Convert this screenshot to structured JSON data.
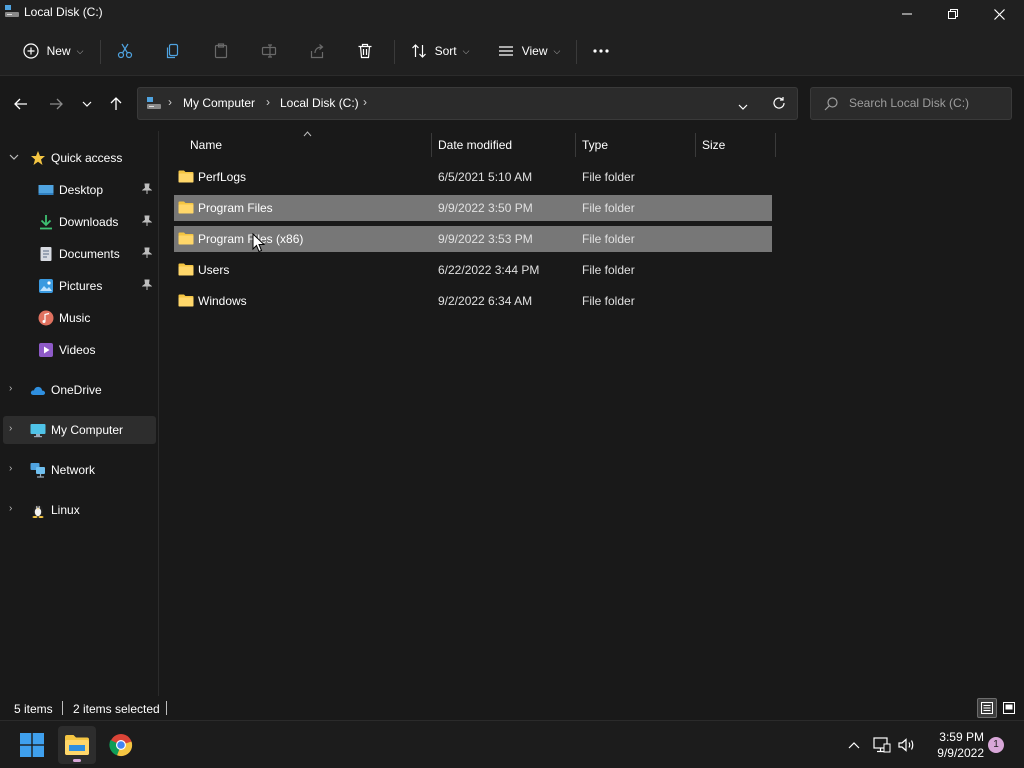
{
  "window": {
    "title": "Local Disk (C:)"
  },
  "command_bar": {
    "new_label": "New",
    "sort_label": "Sort",
    "view_label": "View"
  },
  "address": {
    "breadcrumbs": [
      "My Computer",
      "Local Disk (C:)"
    ]
  },
  "search": {
    "placeholder": "Search Local Disk (C:)"
  },
  "sidebar": {
    "items": [
      {
        "label": "Quick access",
        "icon": "star-icon"
      },
      {
        "label": "Desktop",
        "icon": "desktop-icon",
        "pinned": true
      },
      {
        "label": "Downloads",
        "icon": "download-icon",
        "pinned": true
      },
      {
        "label": "Documents",
        "icon": "documents-icon",
        "pinned": true
      },
      {
        "label": "Pictures",
        "icon": "pictures-icon",
        "pinned": true
      },
      {
        "label": "Music",
        "icon": "music-icon"
      },
      {
        "label": "Videos",
        "icon": "videos-icon"
      },
      {
        "label": "OneDrive",
        "icon": "onedrive-icon"
      },
      {
        "label": "My Computer",
        "icon": "computer-icon",
        "selected": true
      },
      {
        "label": "Network",
        "icon": "network-icon"
      },
      {
        "label": "Linux",
        "icon": "linux-icon"
      }
    ]
  },
  "file_list": {
    "columns": [
      "Name",
      "Date modified",
      "Type",
      "Size"
    ],
    "rows": [
      {
        "name": "PerfLogs",
        "date": "6/5/2021 5:10 AM",
        "type": "File folder",
        "size": "",
        "selected": false
      },
      {
        "name": "Program Files",
        "date": "9/9/2022 3:50 PM",
        "type": "File folder",
        "size": "",
        "selected": true
      },
      {
        "name": "Program Files (x86)",
        "date": "9/9/2022 3:53 PM",
        "type": "File folder",
        "size": "",
        "selected": true
      },
      {
        "name": "Users",
        "date": "6/22/2022 3:44 PM",
        "type": "File folder",
        "size": "",
        "selected": false
      },
      {
        "name": "Windows",
        "date": "9/2/2022 6:34 AM",
        "type": "File folder",
        "size": "",
        "selected": false
      }
    ]
  },
  "status": {
    "item_count": "5 items",
    "selection": "2 items selected"
  },
  "taskbar": {
    "time": "3:59 PM",
    "date": "9/9/2022",
    "notification_count": "1"
  },
  "colors": {
    "folder": "#f4c542",
    "accent": "#4fa3e0",
    "selection": "#777777",
    "notification": "#d8a7d8"
  }
}
